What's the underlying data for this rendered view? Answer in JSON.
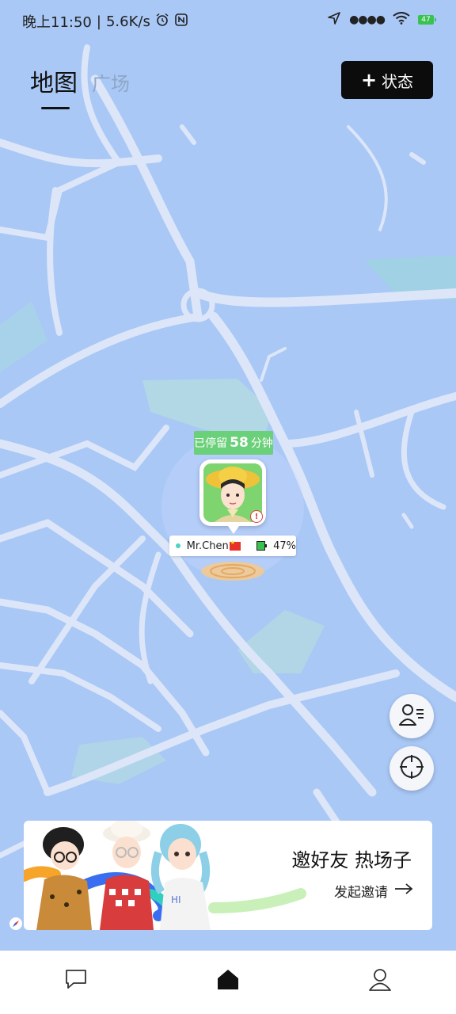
{
  "statusbar": {
    "time": "晚上11:50",
    "speed": "5.6K/s",
    "battery": "47"
  },
  "tabs": [
    {
      "label": "地图",
      "active": true
    },
    {
      "label": "广场",
      "active": false
    }
  ],
  "status_button": {
    "plus": "+",
    "label": "状态"
  },
  "marker": {
    "stay_prefix": "已停留",
    "stay_minutes": "58",
    "stay_suffix": "分钟",
    "name": "Mr.Chen",
    "battery": "47%"
  },
  "invite": {
    "title": "邀好友 热场子",
    "action": "发起邀请"
  },
  "colors": {
    "map_bg": "#a9c8f6",
    "road": "#dce6f8",
    "stay_badge": "#6bd07a",
    "button": "#0c0c0c"
  },
  "icons": {
    "chat": "chat-icon",
    "home": "home-icon",
    "profile": "profile-icon",
    "contacts": "contacts-icon",
    "locate": "locate-icon"
  }
}
